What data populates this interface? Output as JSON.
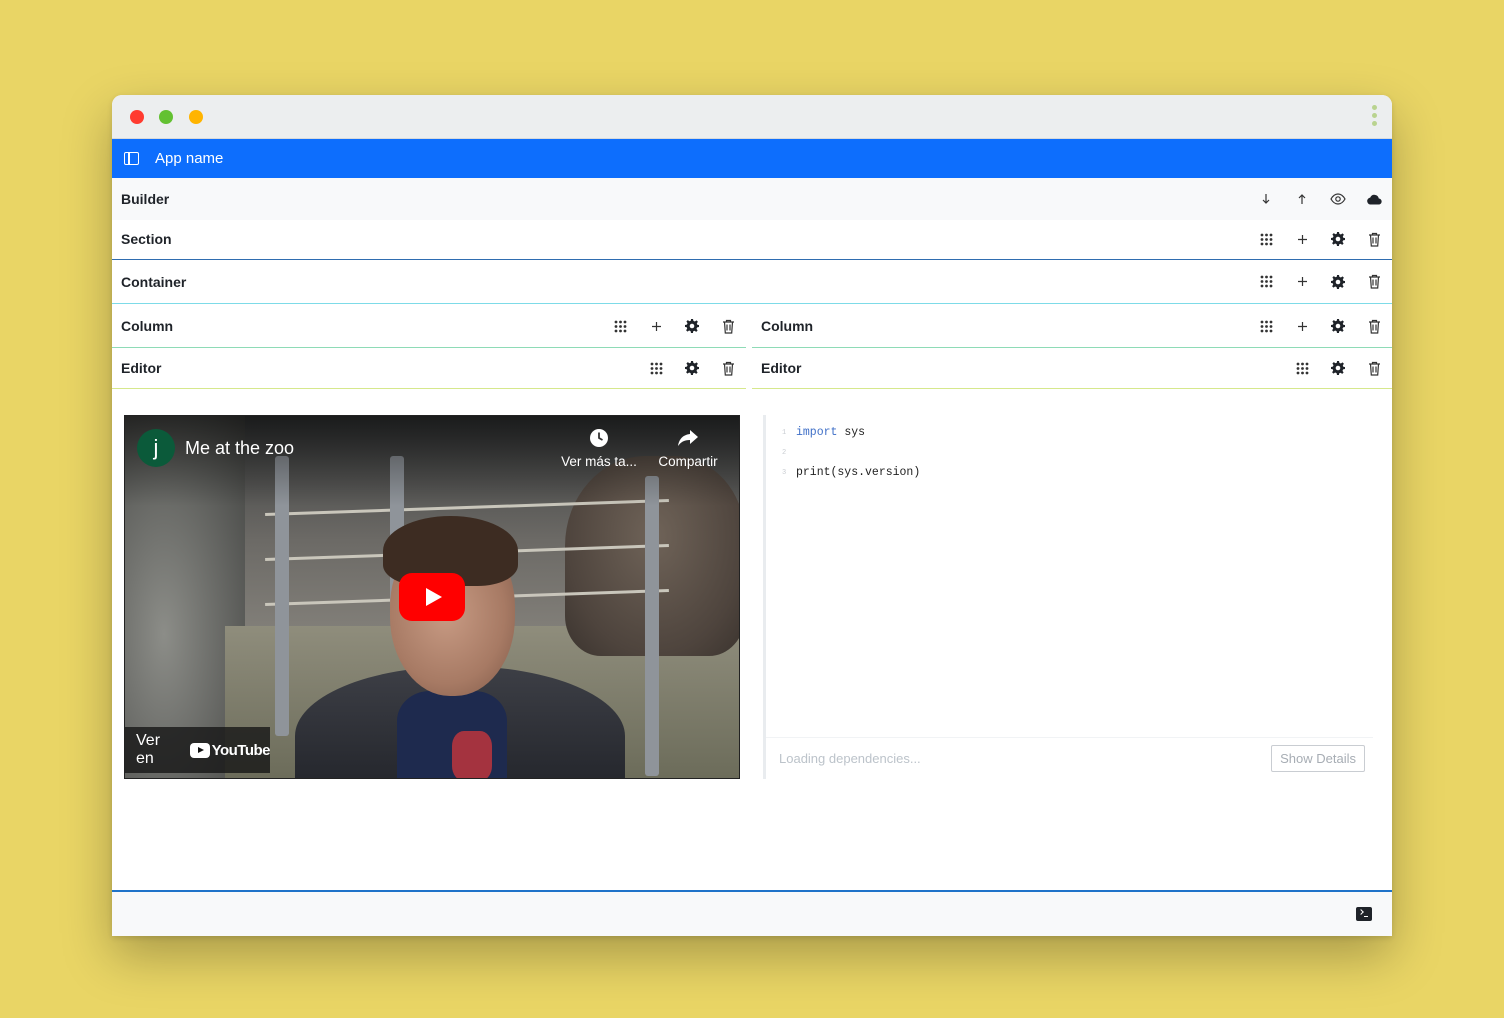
{
  "colors": {
    "page_background": "#e9d565",
    "app_bar": "#0d6efd",
    "window_dot_close": "#ff3b30",
    "window_dot_maximize": "#63c132",
    "window_dot_minimize": "#ffb400",
    "section_border": "#2f6db0",
    "container_border": "#7ddbe8",
    "column_border": "#8edbb6",
    "editor_border": "#d6e88c",
    "footer_border": "#1f73c9",
    "youtube_red": "#ff0000"
  },
  "window": {
    "menu_icon": "kebab-vertical-icon"
  },
  "app": {
    "name": "App name",
    "sidebar_toggle_icon": "sidebar-panel-icon"
  },
  "builder": {
    "label": "Builder",
    "actions": [
      "arrow-down-icon",
      "arrow-up-icon",
      "eye-icon",
      "cloud-icon"
    ]
  },
  "rows": {
    "section": {
      "label": "Section"
    },
    "container": {
      "label": "Container"
    },
    "column_left": {
      "label": "Column"
    },
    "column_right": {
      "label": "Column"
    },
    "editor_left": {
      "label": "Editor"
    },
    "editor_right": {
      "label": "Editor"
    }
  },
  "row_actions": [
    "drag-grid-icon",
    "plus-icon",
    "gear-icon",
    "trash-icon"
  ],
  "video": {
    "channel_initial": "j",
    "title": "Me at the zoo",
    "watch_later_label": "Ver más ta...",
    "share_label": "Compartir",
    "watch_on_label": "Ver en",
    "platform_name": "YouTube"
  },
  "code_editor": {
    "lines": [
      {
        "number": "1",
        "keyword": "import",
        "rest": " sys"
      },
      {
        "number": "2",
        "keyword": "",
        "rest": ""
      },
      {
        "number": "3",
        "keyword": "",
        "rest": "print(sys.version)"
      }
    ],
    "status_text": "Loading dependencies...",
    "details_button": "Show Details"
  },
  "footer": {
    "terminal_icon": "terminal-icon"
  }
}
